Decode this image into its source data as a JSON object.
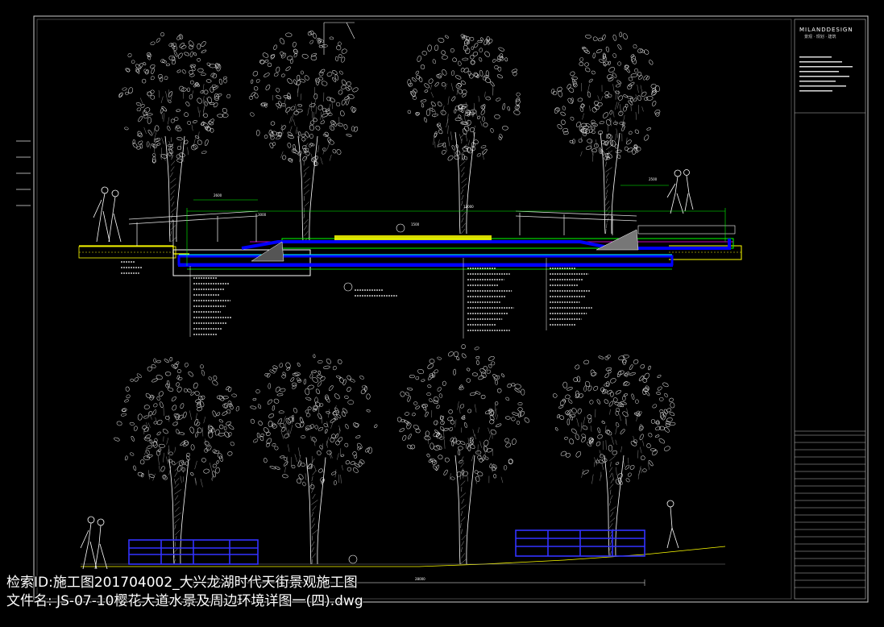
{
  "overlay": {
    "line1": "检索ID:施工图201704002_大兴龙湖时代天街景观施工图",
    "line2": "文件名:  JS-07-10樱花大道水景及周边环境详图一(四).dwg"
  },
  "title_block": {
    "brand": "MILANDDESIGN",
    "subtitle": "景观 · 规划 · 建筑"
  },
  "colors": {
    "background": "#000000",
    "line": "#ffffff",
    "water": "#0000ff",
    "yellow": "#ffff00",
    "green": "#00ff00",
    "cyan": "#00ffff",
    "magenta": "#ff00ff",
    "railing": "#2a2aff"
  },
  "icons": [
    "tree-canopy-icon",
    "pedestrian-icon",
    "railing-icon",
    "section-marker-icon"
  ]
}
